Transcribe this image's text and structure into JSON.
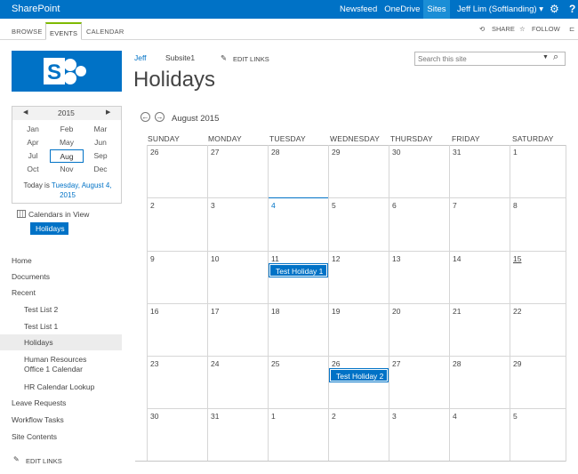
{
  "suitebar": {
    "brand": "SharePoint",
    "links": [
      "Newsfeed",
      "OneDrive",
      "Sites"
    ],
    "user": "Jeff Lim (Softlanding) ▾",
    "settings_icon": "gear-icon",
    "help": "?"
  },
  "ribbon": {
    "tabs": [
      "BROWSE",
      "EVENTS",
      "CALENDAR"
    ],
    "share": "SHARE",
    "follow": "FOLLOW"
  },
  "breadcrumb": {
    "site": "Jeff",
    "subsite": "Subsite1",
    "edit_links": "EDIT LINKS"
  },
  "page_title": "Holidays",
  "search": {
    "placeholder": "Search this site"
  },
  "picker": {
    "year": "2015",
    "months": [
      [
        "Jan",
        "Feb",
        "Mar"
      ],
      [
        "Apr",
        "May",
        "Jun"
      ],
      [
        "Jul",
        "Aug",
        "Sep"
      ],
      [
        "Oct",
        "Nov",
        "Dec"
      ]
    ],
    "selected": "Aug",
    "today_prefix": "Today is ",
    "today_line1": "Tuesday, August 4,",
    "today_line2": "2015"
  },
  "calendars_in_view": {
    "label": "Calendars in View",
    "item": "Holidays"
  },
  "nav": {
    "home": "Home",
    "documents": "Documents",
    "recent": "Recent",
    "recent_items": [
      "Test List 2",
      "Test List 1",
      "Holidays",
      "Human Resources",
      "Office 1 Calendar",
      "HR Calendar Lookup"
    ],
    "leave": "Leave Requests",
    "workflow": "Workflow Tasks",
    "site_contents": "Site Contents",
    "edit_links": "EDIT LINKS"
  },
  "calendar": {
    "month_label": "August 2015",
    "days": [
      "SUNDAY",
      "MONDAY",
      "TUESDAY",
      "WEDNESDAY",
      "THURSDAY",
      "FRIDAY",
      "SATURDAY"
    ],
    "weeks": [
      [
        "26",
        "27",
        "28",
        "29",
        "30",
        "31",
        "1"
      ],
      [
        "2",
        "3",
        "4",
        "5",
        "6",
        "7",
        "8"
      ],
      [
        "9",
        "10",
        "11",
        "12",
        "13",
        "14",
        "15"
      ],
      [
        "16",
        "17",
        "18",
        "19",
        "20",
        "21",
        "22"
      ],
      [
        "23",
        "24",
        "25",
        "26",
        "27",
        "28",
        "29"
      ],
      [
        "30",
        "31",
        "1",
        "2",
        "3",
        "4",
        "5"
      ]
    ],
    "today": "4",
    "events": [
      "Test Holiday 1",
      "Test Holiday 2"
    ]
  }
}
